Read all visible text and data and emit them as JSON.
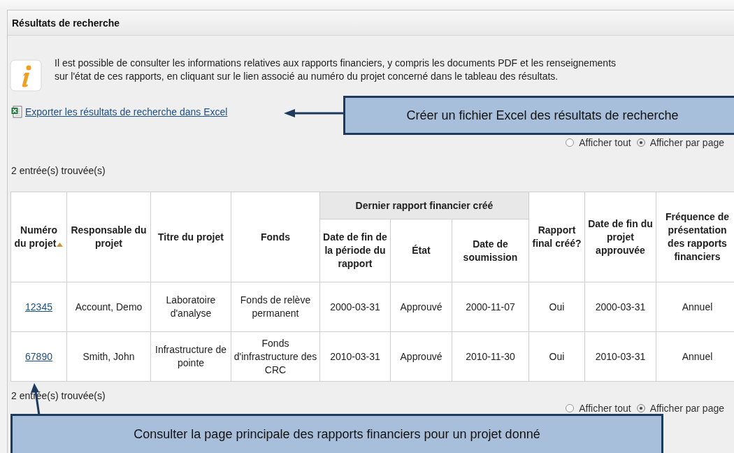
{
  "panel": {
    "title": "Résultats de recherche"
  },
  "info": {
    "lines": [
      "Il est possible de consulter les informations relatives aux rapports financiers, y compris les documents PDF et les renseignements",
      "sur l'état de ces rapports, en cliquant sur le lien associé au numéro du projet concerné dans le tableau des résultats."
    ]
  },
  "export_link": {
    "label": "Exporter les résultats de recherche dans Excel"
  },
  "view_options_top": [
    {
      "label": "Afficher tout",
      "selected": false
    },
    {
      "label": "Afficher par page",
      "selected": true
    }
  ],
  "count_top": "2 entrée(s) trouvée(s)",
  "table": {
    "group_header": "Dernier rapport financier créé",
    "columns": [
      {
        "label": "Numéro du projet",
        "group": false,
        "sorted": true,
        "kind": "link"
      },
      {
        "label": "Responsable du projet",
        "group": false,
        "sorted": false,
        "kind": "text"
      },
      {
        "label": "Titre du projet",
        "group": false,
        "sorted": false,
        "kind": "text"
      },
      {
        "label": "Fonds",
        "group": false,
        "sorted": false,
        "kind": "text"
      },
      {
        "label": "Date de fin de la période du rapport",
        "group": true,
        "sorted": false,
        "kind": "text"
      },
      {
        "label": "État",
        "group": true,
        "sorted": false,
        "kind": "text"
      },
      {
        "label": "Date de soumission",
        "group": true,
        "sorted": false,
        "kind": "text"
      },
      {
        "label": "Rapport final créé?",
        "group": false,
        "sorted": false,
        "kind": "text"
      },
      {
        "label": "Date de fin du projet approuvée",
        "group": false,
        "sorted": false,
        "kind": "text"
      },
      {
        "label": "Fréquence de présentation des rapports financiers",
        "group": false,
        "sorted": false,
        "kind": "text"
      }
    ],
    "rows": [
      [
        "12345",
        "Account, Demo",
        "Laboratoire d'analyse",
        "Fonds de relève permanent",
        "2000-03-31",
        "Approuvé",
        "2000-11-07",
        "Oui",
        "2000-03-31",
        "Annuel"
      ],
      [
        "67890",
        "Smith, John",
        "Infrastructure de pointe",
        "Fonds d'infrastructure des CRC",
        "2010-03-31",
        "Approuvé",
        "2010-11-30",
        "Oui",
        "2010-03-31",
        "Annuel"
      ]
    ]
  },
  "count_bottom": "2 entrée(s) trouvée(s)",
  "view_options_bottom": [
    {
      "label": "Afficher tout",
      "selected": false
    },
    {
      "label": "Afficher par page",
      "selected": true
    }
  ],
  "callouts": [
    {
      "text": "Créer un fichier Excel des résultats de recherche"
    },
    {
      "text": "Consulter la page principale des rapports financiers pour un projet donné"
    }
  ]
}
